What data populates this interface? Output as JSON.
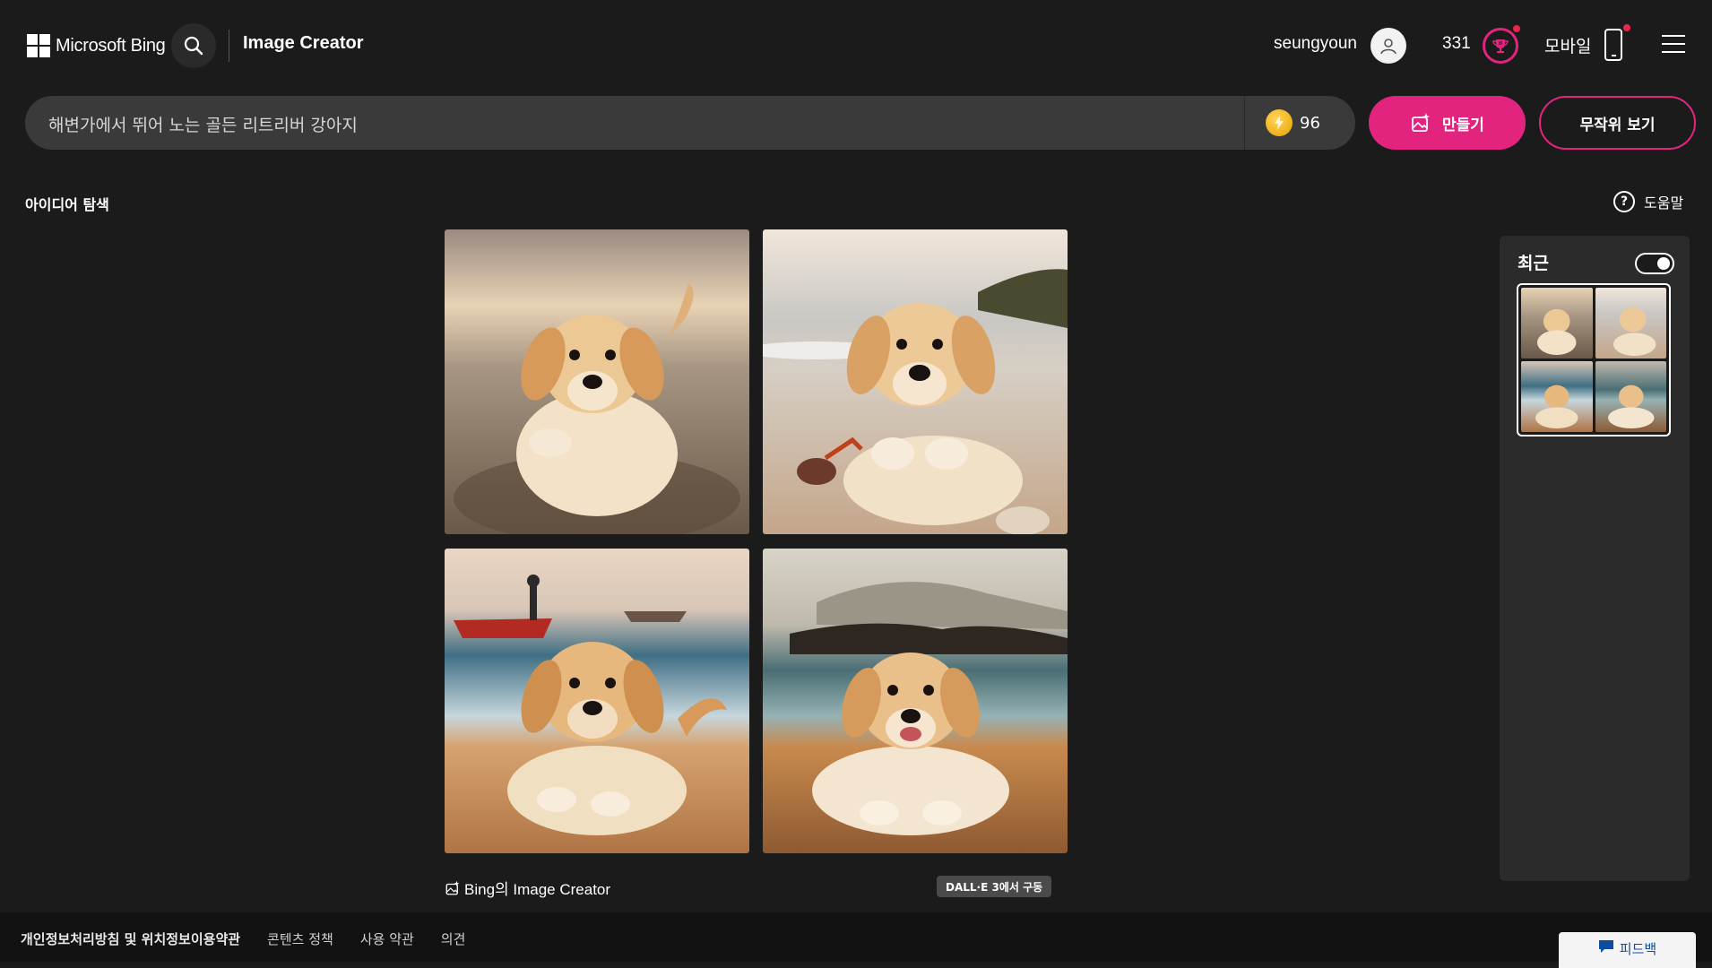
{
  "header": {
    "logo_text": "Microsoft Bing",
    "search_icon": "search-icon",
    "title": "Image Creator",
    "username": "seungyoun",
    "points": "331",
    "mobile_label": "모바일",
    "menu_icon": "hamburger-menu-icon"
  },
  "prompt": {
    "value": "해변가에서 뛰어 노는 골든 리트리버 강아지",
    "boosts": "96",
    "create_label": "만들기",
    "surprise_label": "무작위 보기"
  },
  "explore_label": "아이디어 탐색",
  "help_label": "도움말",
  "results": {
    "caption": "Bing의 Image Creator",
    "badge": "DALL·E 3에서 구동",
    "images": [
      {
        "alt": "골든 리트리버 강아지"
      },
      {
        "alt": "골든 리트리버 강아지"
      },
      {
        "alt": "골든 리트리버 강아지"
      },
      {
        "alt": "골든 리트리버 강아지"
      }
    ]
  },
  "recent": {
    "title": "최근",
    "toggle_on": true
  },
  "footer": {
    "links": [
      "개인정보처리방침 및 위치정보이용약관",
      "콘텐츠 정책",
      "사용 약관",
      "의견"
    ],
    "feedback_label": "피드백"
  },
  "colors": {
    "accent": "#e3247f",
    "background": "#1b1b1b",
    "notification": "#e8264b"
  }
}
